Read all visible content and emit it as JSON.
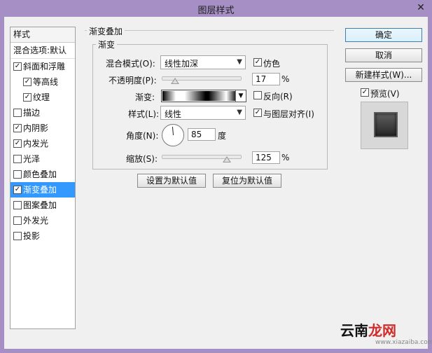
{
  "window": {
    "title": "图层样式"
  },
  "styles": {
    "header": "样式",
    "blend_options": "混合选项:默认",
    "items": [
      {
        "label": "斜面和浮雕",
        "checked": true,
        "indent": false,
        "selected": false
      },
      {
        "label": "等高线",
        "checked": true,
        "indent": true,
        "selected": false
      },
      {
        "label": "纹理",
        "checked": true,
        "indent": true,
        "selected": false
      },
      {
        "label": "描边",
        "checked": false,
        "indent": false,
        "selected": false
      },
      {
        "label": "内阴影",
        "checked": true,
        "indent": false,
        "selected": false
      },
      {
        "label": "内发光",
        "checked": true,
        "indent": false,
        "selected": false
      },
      {
        "label": "光泽",
        "checked": false,
        "indent": false,
        "selected": false
      },
      {
        "label": "颜色叠加",
        "checked": false,
        "indent": false,
        "selected": false
      },
      {
        "label": "渐变叠加",
        "checked": true,
        "indent": false,
        "selected": true
      },
      {
        "label": "图案叠加",
        "checked": false,
        "indent": false,
        "selected": false
      },
      {
        "label": "外发光",
        "checked": false,
        "indent": false,
        "selected": false
      },
      {
        "label": "投影",
        "checked": false,
        "indent": false,
        "selected": false
      }
    ]
  },
  "panel": {
    "title": "渐变叠加",
    "group_title": "渐变",
    "blend_mode_label": "混合模式(O):",
    "blend_mode_value": "线性加深",
    "dither_label": "仿色",
    "dither_checked": true,
    "opacity_label": "不透明度(P):",
    "opacity_value": "17",
    "opacity_fraction": 0.17,
    "percent": "%",
    "gradient_label": "渐变:",
    "reverse_label": "反向(R)",
    "reverse_checked": false,
    "style_label": "样式(L):",
    "style_value": "线性",
    "align_label": "与图层对齐(I)",
    "align_checked": true,
    "angle_label": "角度(N):",
    "angle_value": "85",
    "degree_unit": "度",
    "scale_label": "缩放(S):",
    "scale_value": "125",
    "scale_fraction": 0.83,
    "set_default_button": "设置为默认值",
    "reset_default_button": "复位为默认值"
  },
  "actions": {
    "ok": "确定",
    "cancel": "取消",
    "new_style": "新建样式(W)...",
    "preview_label": "预览(V)",
    "preview_checked": true
  },
  "watermark": {
    "text_left": "云南",
    "text_accent": "龙网",
    "sub": "www.xiazaiba.com"
  }
}
